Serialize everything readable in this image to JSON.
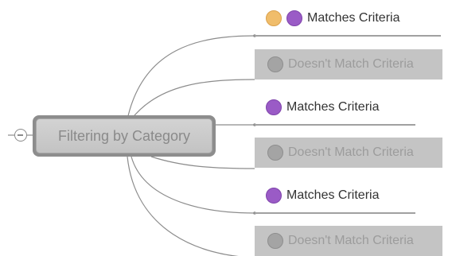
{
  "colors": {
    "canvas_background": "#ffffff",
    "central_topic_frame": "#8d8d8d",
    "central_topic_fill": "#c8c8c8",
    "nonmatching_topic_fill": "#c4c4c4",
    "connector_line": "#8c8c8c",
    "marker_orange": "#f0bd6b",
    "marker_purple": "#9a5bc6",
    "marker_grey": "#a4a4a4"
  },
  "central_topic": {
    "label": "Filtering by Category",
    "toggle_icon": "collapse-minus-icon"
  },
  "subtopics": [
    {
      "label": "Matches Criteria",
      "state": "match",
      "markers": [
        "orange-marker-icon",
        "purple-marker-icon"
      ]
    },
    {
      "label": "Doesn't Match Criteria",
      "state": "nomatch",
      "markers": [
        "grey-marker-icon"
      ]
    },
    {
      "label": "Matches Criteria",
      "state": "match",
      "markers": [
        "purple-marker-icon"
      ]
    },
    {
      "label": "Doesn't Match Criteria",
      "state": "nomatch",
      "markers": [
        "grey-marker-icon"
      ]
    },
    {
      "label": "Matches Criteria",
      "state": "match",
      "markers": [
        "purple-marker-icon"
      ]
    },
    {
      "label": "Doesn't Match Criteria",
      "state": "nomatch",
      "markers": [
        "grey-marker-icon"
      ]
    }
  ]
}
